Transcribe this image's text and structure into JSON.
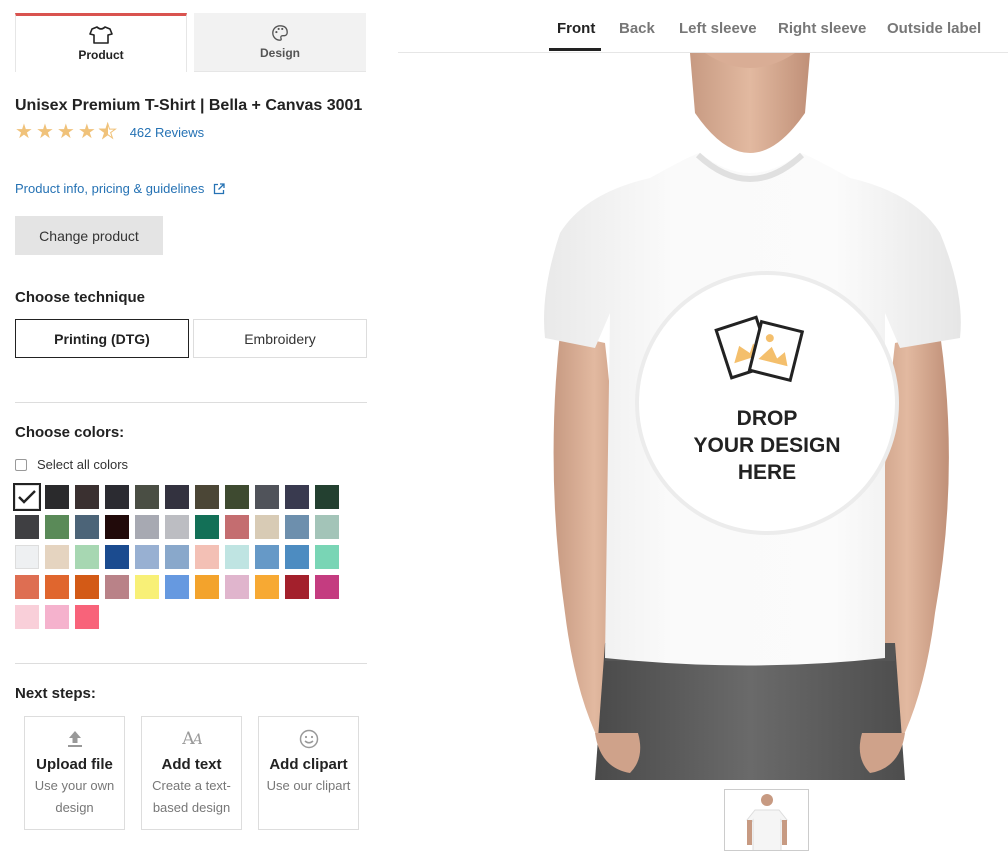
{
  "tabs": [
    {
      "label": "Product",
      "icon": "tshirt-icon"
    },
    {
      "label": "Design",
      "icon": "palette-icon"
    }
  ],
  "product": {
    "title": "Unisex Premium T-Shirt | Bella + Canvas 3001",
    "rating": 4.5,
    "reviews": "462 Reviews",
    "info_link": "Product info, pricing & guidelines",
    "change_button": "Change product"
  },
  "technique": {
    "heading": "Choose technique",
    "options": [
      "Printing (DTG)",
      "Embroidery"
    ],
    "selected": "Printing (DTG)"
  },
  "colors": {
    "heading": "Choose colors:",
    "select_all": "Select all colors",
    "swatches": [
      "#ffffff",
      "#2a2a2c",
      "#3a3030",
      "#2b2b31",
      "#4a4e44",
      "#33323f",
      "#4b4636",
      "#3e4a30",
      "#50535a",
      "#393a4f",
      "#234030",
      "#3f3f42",
      "#5a8a58",
      "#4c6478",
      "#210a0a",
      "#a7a9b2",
      "#bcbdc2",
      "#137057",
      "#c46d70",
      "#d8cbb5",
      "#6d8fad",
      "#a3c4b8",
      "#eef0f2",
      "#e5d4c0",
      "#a7d7b2",
      "#1b4b8f",
      "#98b0d2",
      "#89a8cb",
      "#f3c0b5",
      "#bfe4e2",
      "#6699c7",
      "#4d8cc1",
      "#79d5b5",
      "#de6e52",
      "#e0662e",
      "#d35a16",
      "#b98288",
      "#f8f077",
      "#6699e0",
      "#f3a32c",
      "#e0b5cd",
      "#f7a933",
      "#a3202c",
      "#c43c80",
      "#f9cfd9",
      "#f5b2cd",
      "#f8637a"
    ]
  },
  "next_steps": {
    "heading": "Next steps:",
    "items": [
      {
        "title": "Upload file",
        "desc": "Use your own design",
        "icon": "upload-icon"
      },
      {
        "title": "Add text",
        "desc": "Create a text-based design",
        "icon": "text-icon"
      },
      {
        "title": "Add clipart",
        "desc": "Use our clipart",
        "icon": "smiley-icon"
      }
    ]
  },
  "views": [
    "Front",
    "Back",
    "Left sleeve",
    "Right sleeve",
    "Outside label"
  ],
  "active_view": "Front",
  "drop_zone": {
    "line1": "DROP",
    "line2": "YOUR DESIGN",
    "line3": "HERE"
  }
}
